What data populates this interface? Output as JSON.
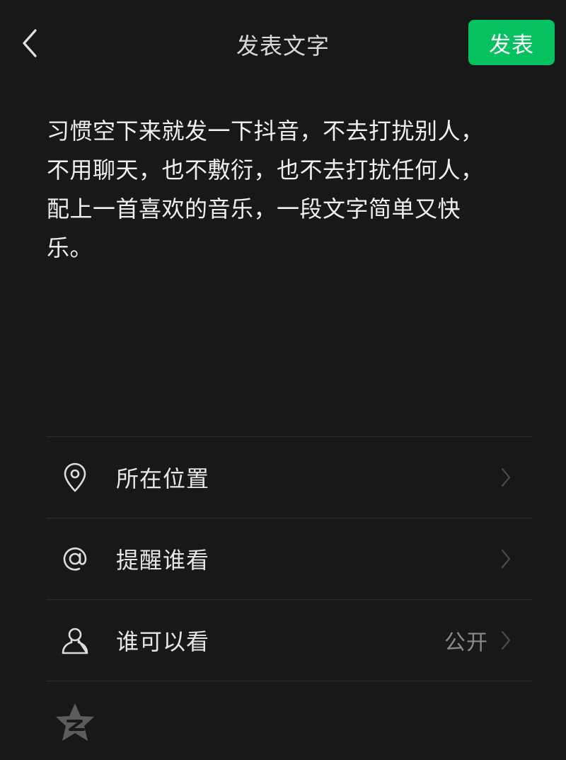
{
  "header": {
    "title": "发表文字",
    "post_label": "发表"
  },
  "content": {
    "text": "习惯空下来就发一下抖音，不去打扰别人，\n不用聊天，也不敷衍，也不去打扰任何人，\n配上一首喜欢的音乐，一段文字简单又快\n乐。"
  },
  "options": [
    {
      "label": "所在位置",
      "icon": "location-pin-icon",
      "value": ""
    },
    {
      "label": "提醒谁看",
      "icon": "at-icon",
      "value": ""
    },
    {
      "label": "谁可以看",
      "icon": "person-icon",
      "value": "公开"
    }
  ],
  "footer": {
    "icon": "qzone-star-icon"
  },
  "colors": {
    "background": "#181818",
    "accent": "#06c160",
    "divider": "#2c2c2c"
  }
}
